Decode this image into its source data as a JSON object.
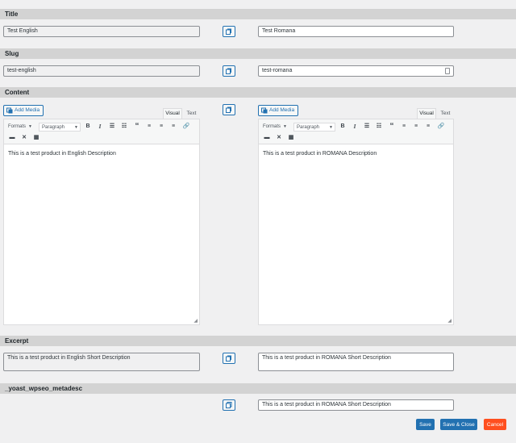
{
  "sections": {
    "title": "Title",
    "slug": "Slug",
    "content": "Content",
    "excerpt": "Excerpt",
    "yoast": "_yoast_wpseo_metadesc"
  },
  "title": {
    "english_value": "Test English",
    "romana_value": "Test Romana"
  },
  "slug": {
    "english_value": "test-english",
    "romana_value": "test-romana"
  },
  "content": {
    "add_media_label": "Add Media",
    "tab_visual": "Visual",
    "tab_text": "Text",
    "formats_label": "Formats",
    "paragraph_label": "Paragraph",
    "english_body": "This is a test product in English Description",
    "romana_body": "This is a test product in ROMANA Description"
  },
  "excerpt": {
    "english_value": "This is a test product in English Short Description",
    "romana_value": "This is a test product in ROMANA Short Description"
  },
  "yoast": {
    "romana_value": "This is a test product in ROMANA Short Description"
  },
  "actions": {
    "save": "Save",
    "save_close": "Save & Close",
    "cancel": "Cancel"
  },
  "colors": {
    "accent": "#2271b1",
    "danger": "#ff4f1f",
    "section_bg": "#d3d3d3"
  }
}
